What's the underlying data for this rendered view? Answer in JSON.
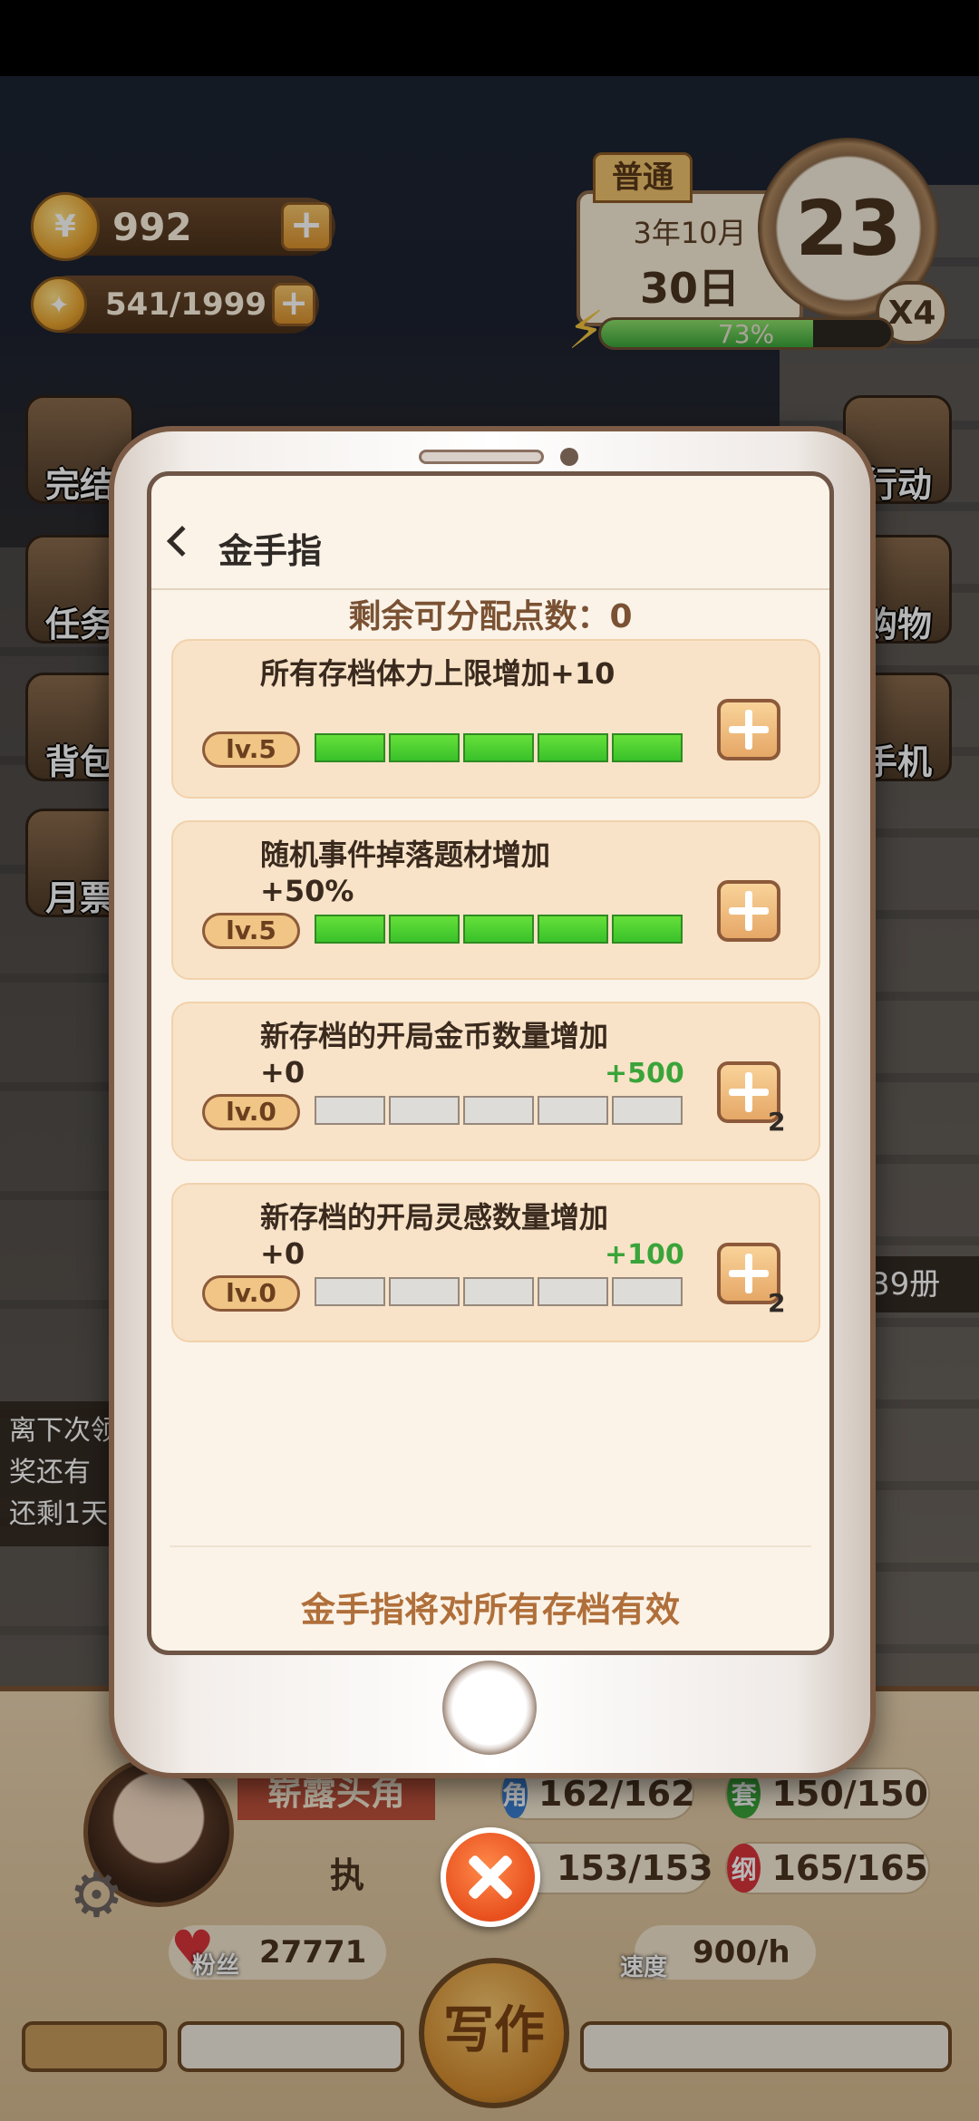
{
  "hud": {
    "coins": "992",
    "inspiration": "541/1999",
    "mode": "普通",
    "year_month": "3年10月",
    "day": "30日",
    "level": "23",
    "multiplier": "X4",
    "energy_percent": "73%",
    "energy_value": 0.73
  },
  "side_left": [
    "完结",
    "任务",
    "背包",
    "月票"
  ],
  "side_right": [
    "行动",
    "购物",
    "手机"
  ],
  "notice_lines": [
    "离下次领",
    "奖还有",
    "还剩1天"
  ],
  "books_label": "39册",
  "modal": {
    "title": "金手指",
    "remaining": "剩余可分配点数：0",
    "items": [
      {
        "desc": "所有存档体力上限增加+10",
        "level": "lv.5",
        "filled": 5,
        "bonus": "",
        "cost": ""
      },
      {
        "desc": "随机事件掉落题材增加+50%",
        "level": "lv.5",
        "filled": 5,
        "bonus": "",
        "cost": ""
      },
      {
        "desc": "新存档的开局金币数量增加+0",
        "level": "lv.0",
        "filled": 0,
        "bonus": "+500",
        "cost": "2"
      },
      {
        "desc": "新存档的开局灵感数量增加+0",
        "level": "lv.0",
        "filled": 0,
        "bonus": "+100",
        "cost": "2"
      }
    ],
    "footer": "金手指将对所有存档有效"
  },
  "profile": {
    "title": "崭露头角",
    "action": "执",
    "stats": [
      {
        "icon": "角",
        "value": "162/162",
        "color": "#3a7fd0"
      },
      {
        "icon": "套",
        "value": "150/150",
        "color": "#3aa43a"
      },
      {
        "icon": "",
        "value": "153/153",
        "color": "#d98a2c"
      },
      {
        "icon": "纲",
        "value": "165/165",
        "color": "#d8343b"
      }
    ],
    "fans_label": "粉丝",
    "fans": "27771",
    "speed_label": "速度",
    "speed": "900/h",
    "write_label": "写作"
  }
}
